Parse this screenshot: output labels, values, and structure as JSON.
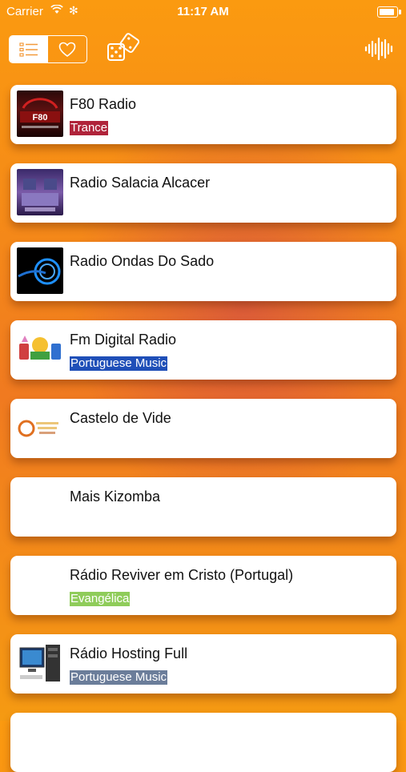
{
  "status_bar": {
    "carrier": "Carrier",
    "time": "11:17 AM"
  },
  "toolbar": {
    "segments": [
      {
        "icon": "list-icon",
        "active": true
      },
      {
        "icon": "heart-icon",
        "active": false
      }
    ],
    "random_icon": "dice-icon",
    "visualizer_icon": "waveform-icon"
  },
  "stations": [
    {
      "name": "F80 Radio",
      "genre": "Trance",
      "genre_color": "#b0233a",
      "logo": "f80-radio-logo"
    },
    {
      "name": "Radio Salacia Alcacer",
      "genre": "",
      "logo": "radio-salacia-logo"
    },
    {
      "name": "Radio Ondas Do Sado",
      "genre": "",
      "logo": "ondas-do-sado-logo"
    },
    {
      "name": "Fm Digital Radio",
      "genre": "Portuguese Music",
      "genre_color": "#1f4fb8",
      "logo": "fm-digital-logo"
    },
    {
      "name": "Castelo de Vide",
      "genre": "",
      "logo": "castelo-de-vide-logo"
    },
    {
      "name": "Mais Kizomba",
      "genre": "",
      "logo": ""
    },
    {
      "name": "Rádio Reviver em Cristo (Portugal)",
      "genre": "Evangélica",
      "genre_color": "#8fcc5a",
      "logo": ""
    },
    {
      "name": "Rádio Hosting Full",
      "genre": "Portuguese Music",
      "genre_color": "#6b7d9a",
      "logo": "hosting-full-logo"
    }
  ]
}
